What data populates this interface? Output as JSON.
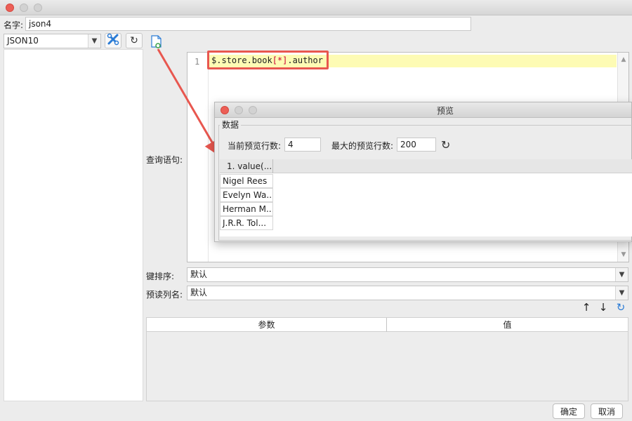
{
  "window": {
    "controls": [
      "close",
      "minimize",
      "zoom"
    ]
  },
  "name_row": {
    "label": "名字:",
    "value": "json4"
  },
  "toolbar": {
    "datasource_selected": "JSON10",
    "icons": [
      "tools-icon",
      "refresh-icon",
      "preview-icon"
    ]
  },
  "query": {
    "label": "查询语句:",
    "line_number": "1",
    "code_prefix": "$.store.book",
    "code_bracket": "[*]",
    "code_suffix": ".author"
  },
  "preview": {
    "title": "预览",
    "group_label": "数据",
    "current_rows_label": "当前预览行数:",
    "current_rows_value": "4",
    "max_rows_label": "最大的预览行数:",
    "max_rows_value": "200",
    "column_header": "1. value(...",
    "rows": [
      "Nigel Rees",
      "Evelyn Wa...",
      "Herman M...",
      "J.R.R. Tol..."
    ]
  },
  "key_sort": {
    "label": "键排序:",
    "value": "默认"
  },
  "preread_columns": {
    "label": "预读列名:",
    "value": "默认"
  },
  "params_table": {
    "col_param": "参数",
    "col_value": "值"
  },
  "footer": {
    "ok_label": "确定",
    "cancel_label": "取消"
  },
  "colors": {
    "highlight_box": "#e8574f",
    "arrow": "#e8574f",
    "current_line": "#fdfbb4",
    "refresh_blue": "#2a7bd5"
  }
}
